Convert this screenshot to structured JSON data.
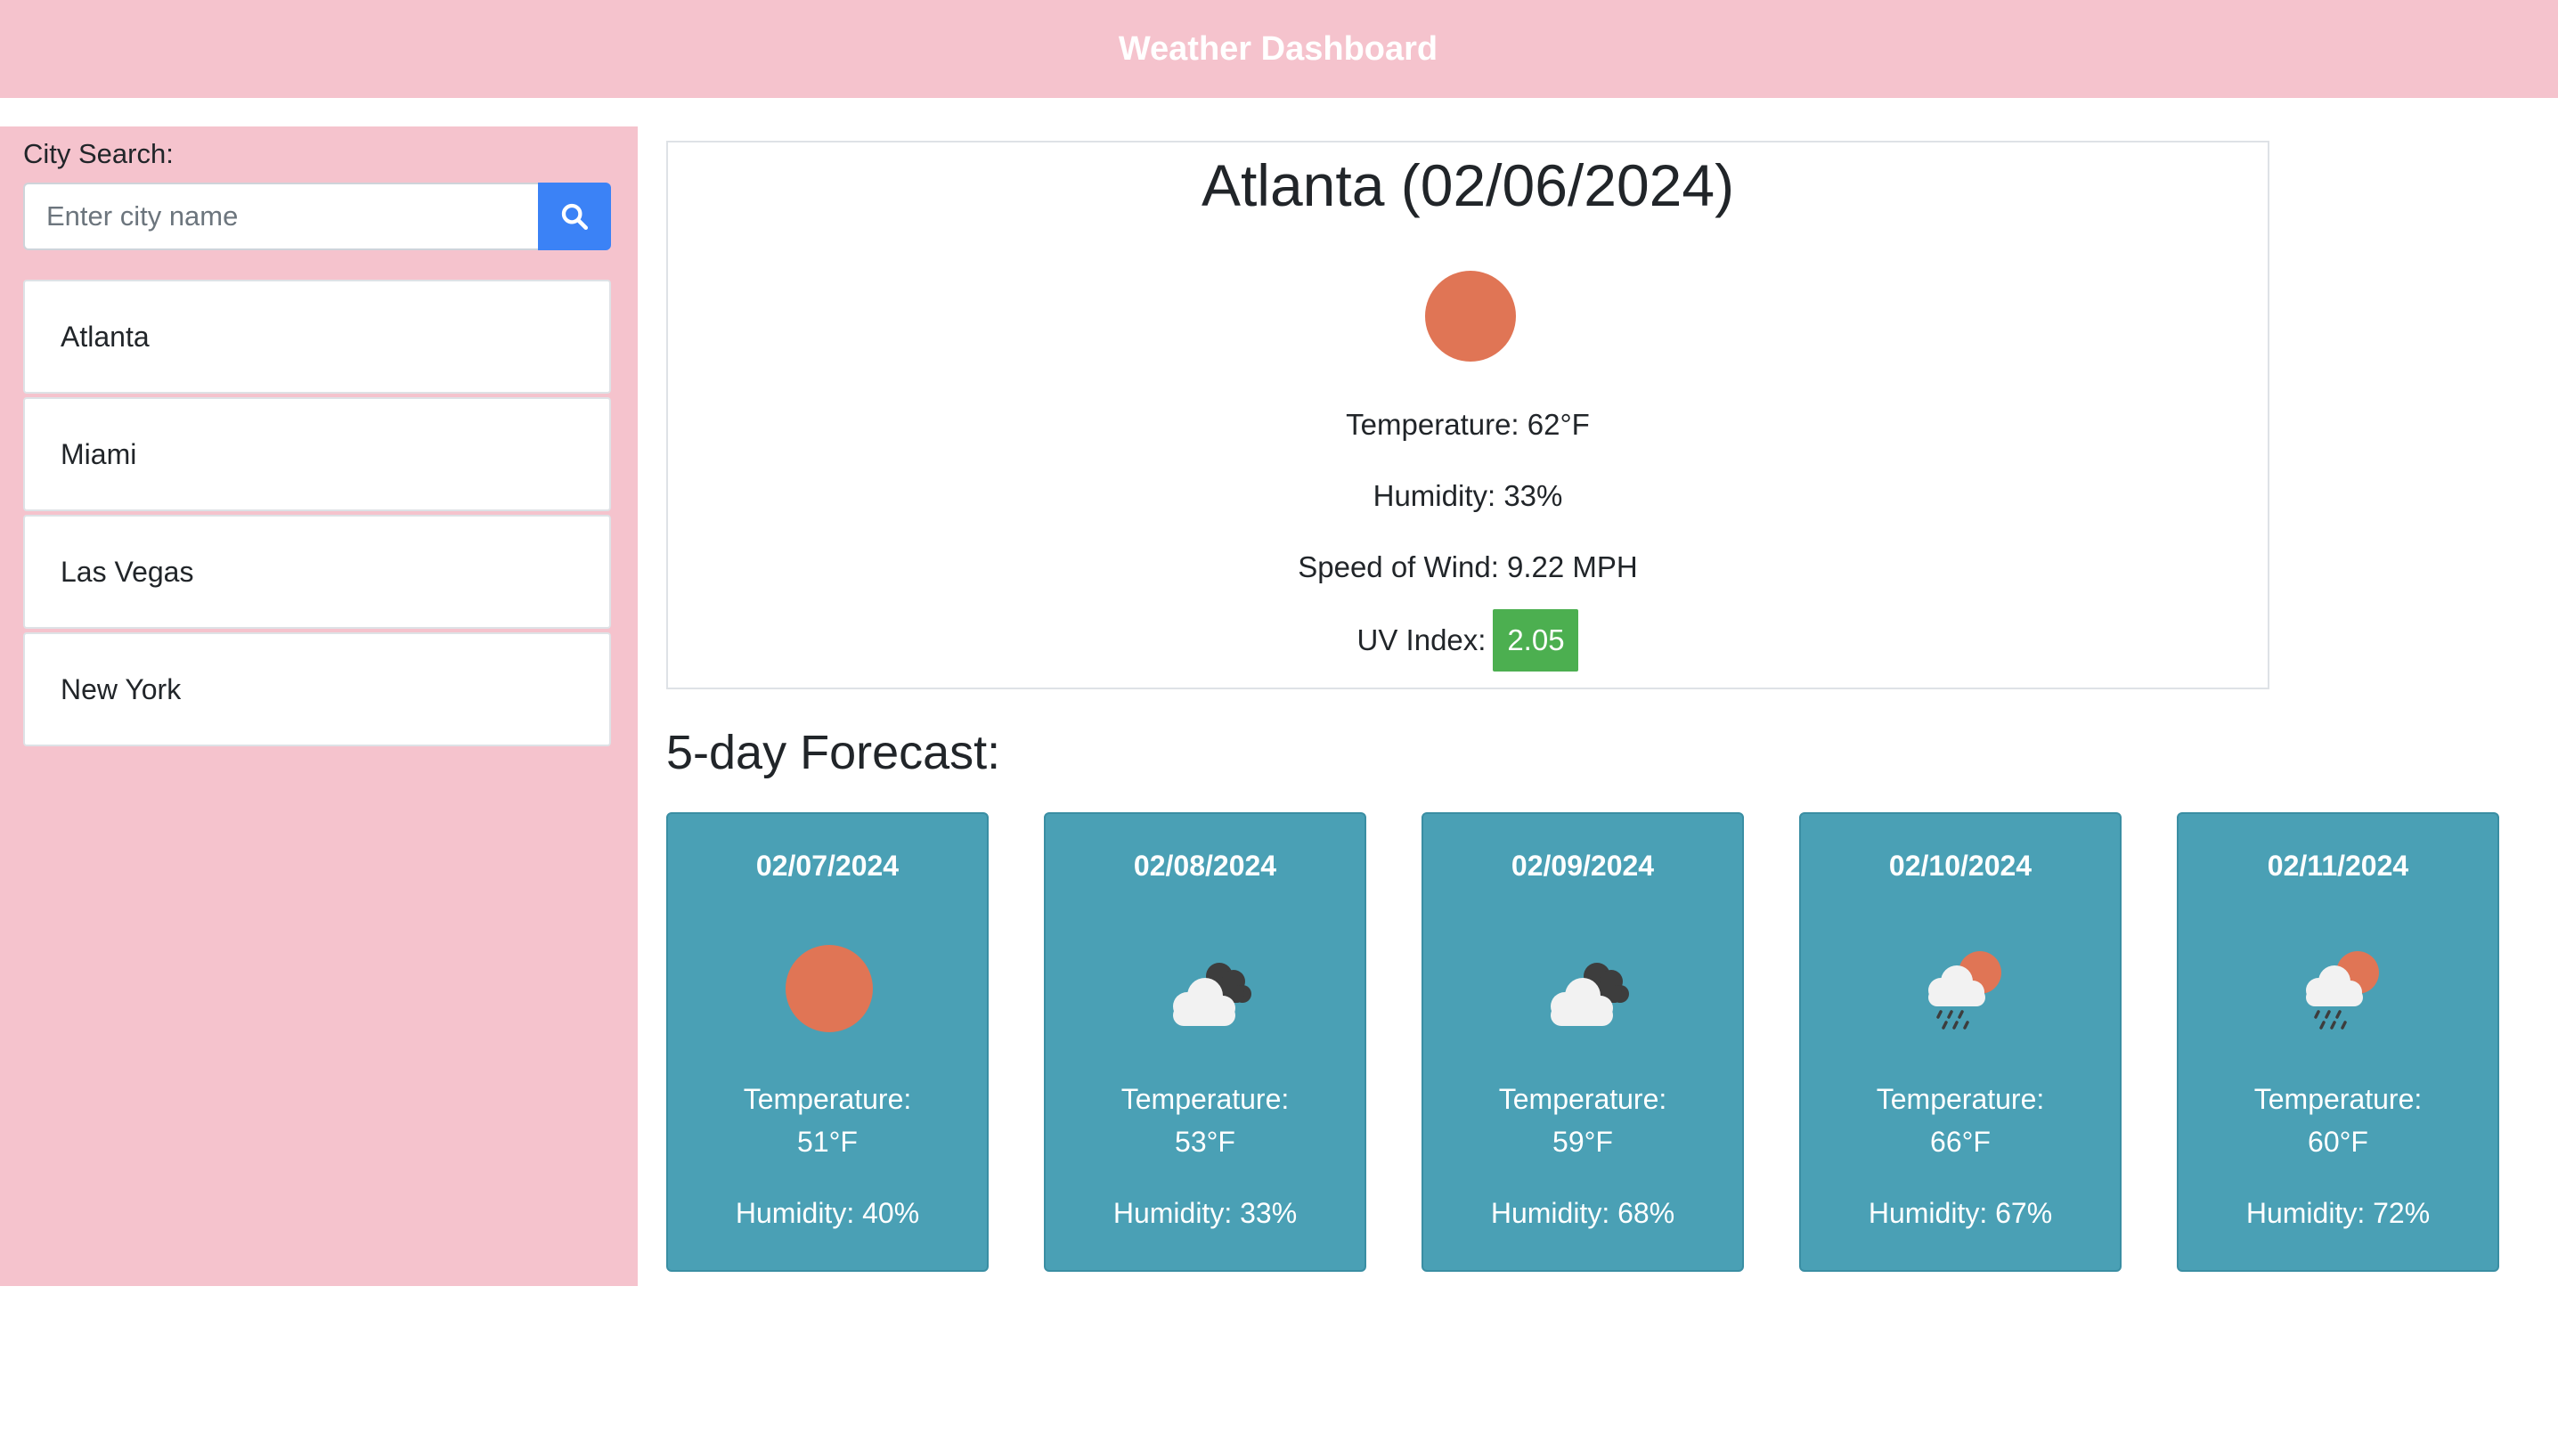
{
  "header": {
    "title": "Weather Dashboard"
  },
  "sidebar": {
    "search_label": "City Search:",
    "search_placeholder": "Enter city name",
    "search_value": "",
    "cities": [
      {
        "label": "Atlanta"
      },
      {
        "label": "Miami"
      },
      {
        "label": "Las Vegas"
      },
      {
        "label": "New York"
      }
    ]
  },
  "current": {
    "title": "Atlanta (02/06/2024)",
    "icon": "sun-icon",
    "temperature": "Temperature: 62°F",
    "humidity": "Humidity: 33%",
    "wind": "Speed of Wind: 9.22 MPH",
    "uv_label": "UV Index:",
    "uv_value": "2.05"
  },
  "forecast": {
    "heading": "5-day Forecast:",
    "days": [
      {
        "date": "02/07/2024",
        "icon": "sun-icon",
        "temp_label": "Temperature:",
        "temp": "51°F",
        "humidity": "Humidity: 40%"
      },
      {
        "date": "02/08/2024",
        "icon": "cloudy-icon",
        "temp_label": "Temperature:",
        "temp": "53°F",
        "humidity": "Humidity: 33%"
      },
      {
        "date": "02/09/2024",
        "icon": "cloudy-icon",
        "temp_label": "Temperature:",
        "temp": "59°F",
        "humidity": "Humidity: 68%"
      },
      {
        "date": "02/10/2024",
        "icon": "rain-sun-icon",
        "temp_label": "Temperature:",
        "temp": "66°F",
        "humidity": "Humidity: 67%"
      },
      {
        "date": "02/11/2024",
        "icon": "rain-sun-icon",
        "temp_label": "Temperature:",
        "temp": "60°F",
        "humidity": "Humidity: 72%"
      }
    ]
  },
  "colors": {
    "header_bg": "#f5c3cd",
    "search_button": "#3b82f6",
    "forecast_card": "#4aa0b5",
    "uv_badge": "#4caf50",
    "sun": "#e07555"
  }
}
